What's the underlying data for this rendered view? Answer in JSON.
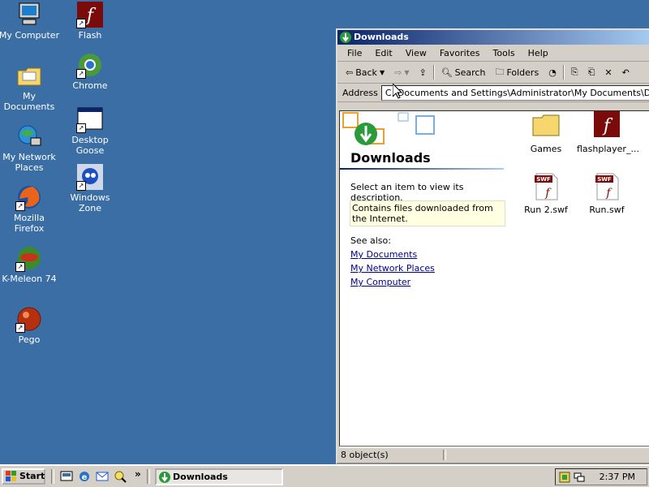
{
  "desktop": {
    "icons": [
      {
        "label": "My Computer"
      },
      {
        "label": "My Documents"
      },
      {
        "label": "My Network Places"
      },
      {
        "label": "Mozilla Firefox"
      },
      {
        "label": "K-Meleon 74"
      },
      {
        "label": "Pego"
      },
      {
        "label": "Flash"
      },
      {
        "label": "Chrome"
      },
      {
        "label": "Desktop Goose"
      },
      {
        "label": "Windows Zone"
      }
    ]
  },
  "window": {
    "title": "Downloads",
    "menu": [
      "File",
      "Edit",
      "View",
      "Favorites",
      "Tools",
      "Help"
    ],
    "toolbar": {
      "back": "Back",
      "search": "Search",
      "folders": "Folders"
    },
    "address_label": "Address",
    "address_value": "C:\\Documents and Settings\\Administrator\\My Documents\\Downloads",
    "left_pane": {
      "title": "Downloads",
      "description": "Select an item to view its description.",
      "info": "Contains files downloaded from the Internet.",
      "see_also": "See also:",
      "links": [
        "My Documents",
        "My Network Places",
        "My Computer"
      ]
    },
    "files": [
      {
        "name": "Games"
      },
      {
        "name": "flashplayer_..."
      },
      {
        "name": "Run 2.swf"
      },
      {
        "name": "Run.swf"
      }
    ],
    "status": "8 object(s)"
  },
  "taskbar": {
    "start_label": "Start",
    "task_label": "Downloads",
    "clock": "2:37 PM"
  },
  "colors": {
    "desktop": "#3a6ea5",
    "titlebar_start": "#0a246a",
    "titlebar_end": "#a6caf0",
    "link": "#00008b",
    "flash_red": "#7b0a0a"
  }
}
